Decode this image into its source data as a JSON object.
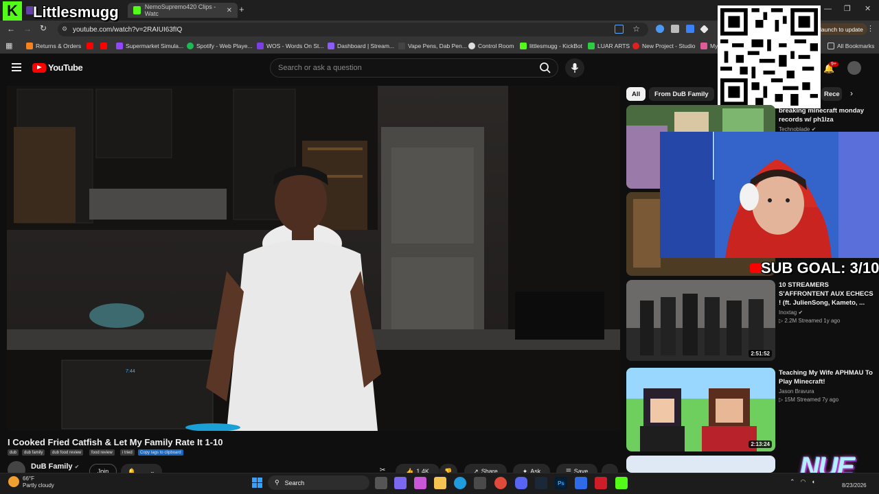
{
  "browser": {
    "tabs": [
      {
        "label": "NemoSupremo420 Clips - Watc"
      }
    ],
    "url": "youtube.com/watch?v=2RAIUI63fIQ",
    "update_label": "launch to update",
    "bookmarks": [
      {
        "label": "Returns & Orders",
        "icon": "orange-square-icon"
      },
      {
        "label": "Supermarket Simula...",
        "icon": "twitch-icon"
      },
      {
        "label": "Spotify - Web Playe...",
        "icon": "spotify-icon"
      },
      {
        "label": "WOS - Words On St...",
        "icon": "purple-w-icon"
      },
      {
        "label": "Dashboard | Stream...",
        "icon": "streamlabs-icon"
      },
      {
        "label": "Vape Pens, Dab Pen...",
        "icon": "blank-icon"
      },
      {
        "label": "Control Room",
        "icon": "gear-icon"
      },
      {
        "label": "littlesmugg - KickBot",
        "icon": "kick-icon"
      },
      {
        "label": "LUAR ARTS",
        "icon": "s-icon"
      },
      {
        "label": "New Project - Studio",
        "icon": "red-icon"
      },
      {
        "label": "My",
        "icon": "m-icon"
      }
    ],
    "all_bookmarks": "All Bookmarks"
  },
  "overlay": {
    "channel_name": "Littlesmugg",
    "sub_goal": "SUB GOAL: 3/10",
    "nue_logo": "NUE"
  },
  "youtube": {
    "logo": "YouTube",
    "search_placeholder": "Search or ask a question",
    "notifications": "9+",
    "chips": [
      "All",
      "From DuB Family",
      "Rece"
    ],
    "video": {
      "title": "I Cooked Fried Catfish & Let My Family Rate It 1-10",
      "tags": [
        "dub",
        "dub family",
        "dub food review",
        "food review",
        "i tried",
        "Copy tags to clipboard"
      ],
      "channel": "DuB Family",
      "join": "Join",
      "likes": "1.4K",
      "share": "Share",
      "ask": "Ask",
      "save": "Save",
      "stove_clock": "7:44"
    },
    "recommendations": [
      {
        "title": "breaking minecraft monday records w/ ph1lza",
        "channel": "Technoblade",
        "meta": "",
        "duration": ""
      },
      {
        "title": "10 STREAMERS S'AFFRONTENT AUX ECHECS ! (ft. JulienSong, Kameto, ...",
        "channel": "Inoxtag",
        "meta": "2.2M  Streamed 1y ago",
        "duration": "2:51:52"
      },
      {
        "title": "Teaching My Wife APHMAU To Play Minecraft!",
        "channel": "Jason Bravura",
        "meta": "15M  Streamed 7y ago",
        "duration": "2:13:24"
      }
    ]
  },
  "taskbar": {
    "weather_temp": "66°F",
    "weather_desc": "Partly cloudy",
    "search_label": "Search",
    "date": "8/23/2026"
  },
  "colors": {
    "accent_red": "#ff0000",
    "kick_green": "#53fc18",
    "cam_blue": "#3f7fe8"
  }
}
